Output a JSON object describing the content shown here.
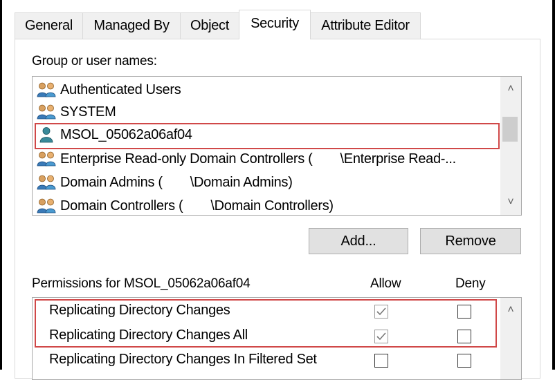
{
  "tabs": [
    {
      "label": "General"
    },
    {
      "label": "Managed By"
    },
    {
      "label": "Object"
    },
    {
      "label": "Security",
      "active": true
    },
    {
      "label": "Attribute Editor"
    }
  ],
  "groups": {
    "label": "Group or user names:",
    "items": [
      {
        "name": "Authenticated Users",
        "icon": "group-icon"
      },
      {
        "name": "SYSTEM",
        "icon": "group-icon"
      },
      {
        "name": "MSOL_05062a06af04",
        "icon": "user-icon",
        "selected": true
      },
      {
        "name": "Enterprise Read-only Domain Controllers (",
        "suffix": "\\Enterprise Read-...",
        "icon": "group-icon"
      },
      {
        "name": "Domain Admins (",
        "suffix": "\\Domain Admins)",
        "icon": "group-icon"
      },
      {
        "name": "Domain Controllers (",
        "suffix": "\\Domain Controllers)",
        "icon": "group-icon"
      }
    ]
  },
  "buttons": {
    "add": "Add...",
    "remove": "Remove"
  },
  "permissions": {
    "label": "Permissions for MSOL_05062a06af04",
    "allow_header": "Allow",
    "deny_header": "Deny",
    "rows": [
      {
        "name": "Replicating Directory Changes",
        "allow": true,
        "deny": false
      },
      {
        "name": "Replicating Directory Changes All",
        "allow": true,
        "deny": false
      },
      {
        "name": "Replicating Directory Changes In Filtered Set",
        "allow": false,
        "deny": false
      }
    ]
  },
  "colors": {
    "highlight": "#d04848",
    "panel_border": "#d9d9d9"
  }
}
